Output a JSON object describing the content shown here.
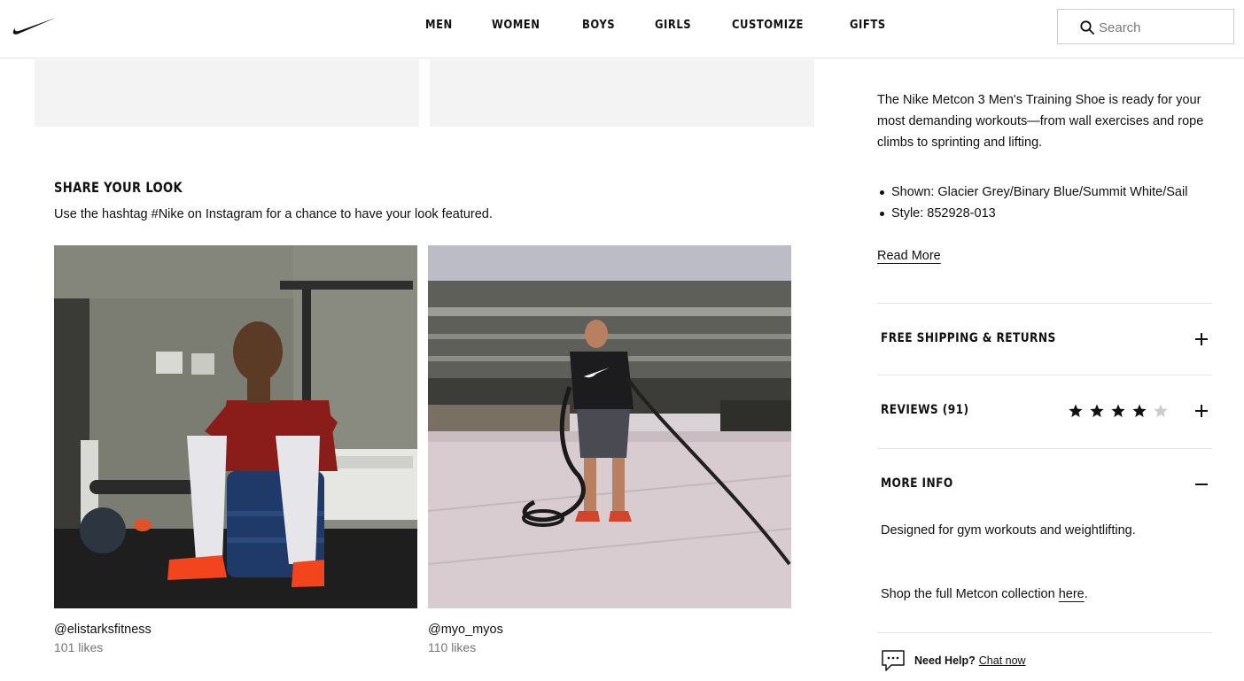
{
  "header": {
    "logo_icon": "nike-swoosh-icon",
    "nav": [
      "MEN",
      "WOMEN",
      "BOYS",
      "GIRLS",
      "CUSTOMIZE",
      "GIFTS"
    ],
    "search_placeholder": "Search",
    "search_icon": "search-icon"
  },
  "share": {
    "title": "SHARE YOUR LOOK",
    "subtitle": "Use the hashtag #Nike on Instagram for a chance to have your look featured.",
    "posts": [
      {
        "handle": "@elistarksfitness",
        "likes": "101 likes"
      },
      {
        "handle": "@myo_myos",
        "likes": "110 likes"
      }
    ]
  },
  "product": {
    "description": "The Nike Metcon 3 Men's Training Shoe is ready for your most demanding workouts—from wall exercises and rope climbs to sprinting and lifting.",
    "bullets": [
      "Shown: Glacier Grey/Binary Blue/Summit White/Sail",
      "Style: 852928-013"
    ],
    "read_more": "Read More"
  },
  "accordion": {
    "shipping_title": "FREE SHIPPING & RETURNS",
    "reviews_title": "REVIEWS (91)",
    "rating": 4,
    "rating_max": 5,
    "more_info_title": "MORE INFO",
    "more_info_text": "Designed for gym workouts and weightlifting.",
    "collection_text": "Shop the full Metcon collection ",
    "collection_link": "here",
    "collection_end": "."
  },
  "help": {
    "icon": "chat-bubble-icon",
    "label": "Need Help?",
    "link": "Chat now"
  },
  "colors": {
    "text": "#111111",
    "muted": "#757575",
    "divider": "#e5e5e5",
    "tile": "#f3f3f4",
    "star_off": "#cccccc"
  }
}
